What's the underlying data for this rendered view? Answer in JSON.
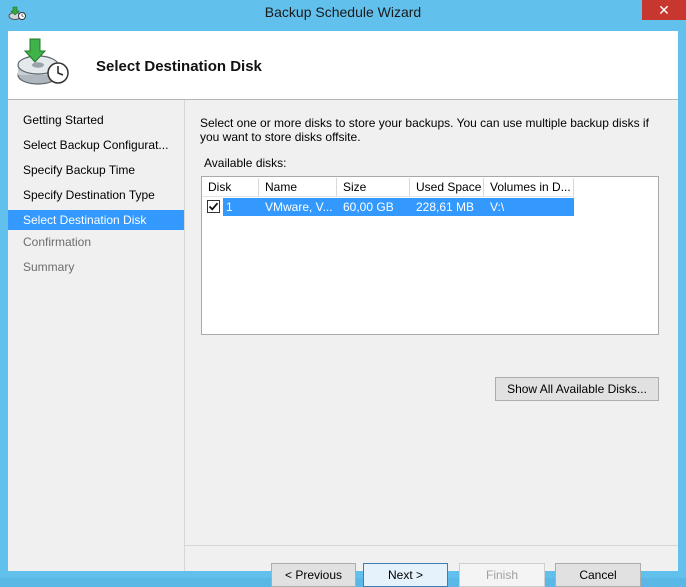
{
  "window": {
    "title": "Backup Schedule Wizard",
    "close_glyph": "✕"
  },
  "header": {
    "title": "Select Destination Disk",
    "icon": "backup-clock-icon"
  },
  "nav": {
    "items": [
      {
        "label": "Getting Started",
        "state": "normal"
      },
      {
        "label": "Select Backup Configurat...",
        "state": "normal"
      },
      {
        "label": "Specify Backup Time",
        "state": "normal"
      },
      {
        "label": "Specify Destination Type",
        "state": "normal"
      },
      {
        "label": "Select Destination Disk",
        "state": "active"
      },
      {
        "label": "Confirmation",
        "state": "disabled"
      },
      {
        "label": "Summary",
        "state": "disabled"
      }
    ]
  },
  "content": {
    "description": "Select one or more disks to store your backups. You can use multiple backup disks if you want to store disks offsite.",
    "available_label": "Available disks:",
    "columns": [
      "Disk",
      "Name",
      "Size",
      "Used Space",
      "Volumes in D..."
    ],
    "rows": [
      {
        "checked": true,
        "disk": "1",
        "name": "VMware, V...",
        "size": "60,00 GB",
        "used": "228,61 MB",
        "volumes": "V:\\"
      }
    ],
    "show_all_button": "Show All Available Disks..."
  },
  "buttons": {
    "previous": "< Previous",
    "next": "Next >",
    "finish": "Finish",
    "cancel": "Cancel"
  },
  "colors": {
    "accent": "#3399ff",
    "title_bar": "#62c1ec",
    "close": "#c7372f"
  }
}
